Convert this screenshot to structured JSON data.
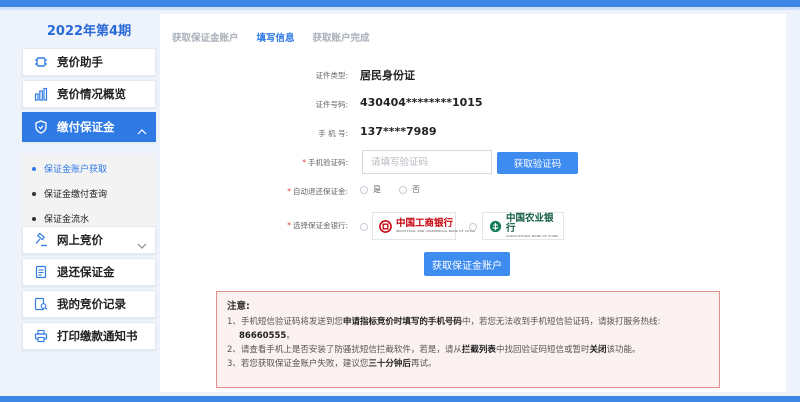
{
  "sidebar": {
    "period_title": "2022年第4期",
    "items": [
      {
        "label": "竞价助手"
      },
      {
        "label": "竞价情况概览"
      },
      {
        "label": "缴付保证金"
      },
      {
        "label": "网上竞价"
      },
      {
        "label": "退还保证金"
      },
      {
        "label": "我的竞价记录"
      },
      {
        "label": "打印缴款通知书"
      }
    ],
    "submenu": [
      {
        "label": "保证金账户获取"
      },
      {
        "label": "保证金缴付查询"
      },
      {
        "label": "保证金流水"
      }
    ]
  },
  "steps": [
    {
      "label": "获取保证金账户"
    },
    {
      "label": "填写信息"
    },
    {
      "label": "获取账户完成"
    }
  ],
  "form": {
    "id_type_label": "证件类型:",
    "id_type_value": "居民身份证",
    "id_number_label": "证件号码:",
    "id_number_value": "430404********1015",
    "phone_label": "手 机 号:",
    "phone_value": "137****7989",
    "sms_label": "手机验证码:",
    "sms_placeholder": "请填写验证码",
    "sms_button": "获取验证码",
    "auto_refund_label": "自动退还保证金:",
    "yes_label": "是",
    "no_label": "否",
    "bank_label": "选择保证金银行:",
    "banks": [
      {
        "name": "中国工商银行",
        "en": "INDUSTRIAL AND COMMERCIAL BANK OF CHINA",
        "color": "#c7000b"
      },
      {
        "name": "中国农业银行",
        "en": "AGRICULTURAL BANK OF CHINA",
        "color": "#0f7a5a"
      }
    ],
    "submit_button": "获取保证金账户"
  },
  "notice": {
    "title": "注意:",
    "line1_a": "1、手机短信验证码将发送到您",
    "line1_b": "申请指标竞价时填写的手机号码",
    "line1_c": "中，若您无法收到手机短信验证码，请拨打服务热线:",
    "hotline": "86660555",
    "hotline_suffix": "。",
    "line2_a": "2、请查看手机上是否安装了防骚扰短信拦截软件，若是，请从",
    "line2_b": "拦截列表",
    "line2_c": "中找回验证码短信或暂时",
    "line2_d": "关闭",
    "line2_e": "该功能。",
    "line3_a": "3、若您获取保证金账户失败，建议您",
    "line3_b": "三十分钟后",
    "line3_c": "再试。"
  },
  "colors": {
    "accent": "#2f7ae5",
    "button": "#3f8cf0",
    "notice_border": "#e58e8e",
    "required": "#e53935"
  }
}
